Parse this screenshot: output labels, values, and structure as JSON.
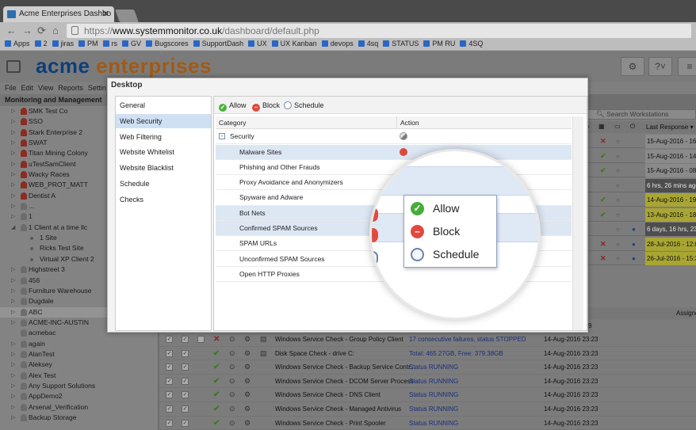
{
  "browser": {
    "tab_title": "Acme Enterprises Dashbo",
    "url_scheme": "https://",
    "url_host": "www.systemmonitor.co.uk",
    "url_path": "/dashboard/default.php",
    "bookmarks": [
      "Apps",
      "2",
      "jiras",
      "PM",
      "rs",
      "GV",
      "Bugscores",
      "SupportDash",
      "UX",
      "UX Kanban",
      "devops",
      "4sq",
      "STATUS",
      "PM RU",
      "4SQ"
    ]
  },
  "app": {
    "title_part1": "acme",
    "title_part2": "enterprises",
    "menu": [
      "File",
      "Edit",
      "View",
      "Reports",
      "Settin"
    ]
  },
  "left_panel": {
    "title": "Monitoring and Management",
    "items": [
      {
        "label": "SMK Test Co",
        "icon": "red-client-icon"
      },
      {
        "label": "SSO",
        "icon": "red-client-icon"
      },
      {
        "label": "Stark Enterprise 2",
        "icon": "red-client-icon"
      },
      {
        "label": "SWAT",
        "icon": "red-client-icon"
      },
      {
        "label": "Titan Mining Colony",
        "icon": "red-client-icon"
      },
      {
        "label": "uTestSamClient",
        "icon": "red-client-icon"
      },
      {
        "label": "Wacky Races",
        "icon": "red-client-icon"
      },
      {
        "label": "WEB_PROT_MATT",
        "icon": "red-client-icon"
      },
      {
        "label": "Dentist A",
        "icon": "red-client-icon"
      },
      {
        "label": "...",
        "icon": "grey-client-icon"
      },
      {
        "label": "1",
        "icon": "grey-client-icon"
      },
      {
        "label": "1 Client at a time llc",
        "icon": "grey-client-icon"
      },
      {
        "label": "1 Site",
        "icon": "site-dot-icon"
      },
      {
        "label": "Ricks Test Site",
        "icon": "site-dot-icon"
      },
      {
        "label": "Virtual XP Client 2",
        "icon": "site-dot-icon"
      },
      {
        "label": "Highstreet 3",
        "icon": "grey-client-icon"
      },
      {
        "label": "456",
        "icon": "grey-client-icon"
      },
      {
        "label": "Furniture Warehouse",
        "icon": "grey-client-icon"
      },
      {
        "label": "Dugdale",
        "icon": "grey-client-icon"
      },
      {
        "label": "ABC",
        "icon": "grey-client-icon"
      },
      {
        "label": "ACME-INC-AUSTIN",
        "icon": "grey-client-icon"
      },
      {
        "label": "acmebac",
        "icon": "grey-client-icon"
      },
      {
        "label": "again",
        "icon": "grey-client-icon"
      },
      {
        "label": "AlanTest",
        "icon": "grey-client-icon"
      },
      {
        "label": "Aleksey",
        "icon": "grey-client-icon"
      },
      {
        "label": "Alex Test",
        "icon": "grey-client-icon"
      },
      {
        "label": "Any Support Solutions",
        "icon": "grey-client-icon"
      },
      {
        "label": "AppDemo2",
        "icon": "grey-client-icon"
      },
      {
        "label": "Arsenal_Verification",
        "icon": "grey-client-icon"
      },
      {
        "label": "Backup Storage",
        "icon": "grey-client-icon"
      }
    ]
  },
  "workstations": {
    "search_placeholder": "Search Workstations",
    "col_last_response": "Last Response",
    "assignee_header": "Assigne",
    "rows": [
      {
        "status": "✕",
        "last_response": "15-Aug-2016 - 16:1"
      },
      {
        "status": "✔",
        "last_response": "15-Aug-2016 - 14:1"
      },
      {
        "status": "✔",
        "last_response": "15-Aug-2016 - 08:2"
      },
      {
        "status": "",
        "last_response": "6 hrs, 26 mins ago"
      },
      {
        "status": "✔",
        "last_response": "14-Aug-2016 - 19:0"
      },
      {
        "status": "✔",
        "last_response": "13-Aug-2016 - 18:1"
      },
      {
        "status": "",
        "last_response": "6 days, 16 hrs, 23 m"
      },
      {
        "status": "✕",
        "last_response": "28-Jul-2016 - 12:07"
      },
      {
        "status": "✕",
        "last_response": "26-Jul-2016 - 15:32"
      }
    ]
  },
  "checks": {
    "partial_top": "9",
    "rows": [
      {
        "status": "✕",
        "desc": "Windows Service Check - Group Policy Client",
        "result": "17 consecutive failures, status STOPPED",
        "date": "14-Aug-2016 23:23"
      },
      {
        "status": "✔",
        "desc": "Disk Space Check - drive C:",
        "result": "Total: 465.27GB, Free: 379.38GB",
        "date": "14-Aug-2016 23:23"
      },
      {
        "status": "✔",
        "desc": "Windows Service Check - Backup Service Contr...",
        "result": "Status RUNNING",
        "date": "14-Aug-2016 23:23"
      },
      {
        "status": "✔",
        "desc": "Windows Service Check - DCOM Server Process ...",
        "result": "Status RUNNING",
        "date": "14-Aug-2016 23:23"
      },
      {
        "status": "✔",
        "desc": "Windows Service Check - DNS Client",
        "result": "Status RUNNING",
        "date": "14-Aug-2016 23:23"
      },
      {
        "status": "✔",
        "desc": "Windows Service Check - Managed Antivirus",
        "result": "Status RUNNING",
        "date": "14-Aug-2016 23:23"
      },
      {
        "status": "✔",
        "desc": "Windows Service Check - Print Spooler",
        "result": "Status RUNNING",
        "date": "14-Aug-2016 23:23"
      }
    ]
  },
  "dialog": {
    "title": "Desktop",
    "nav": [
      "General",
      "Web Security",
      "Web Filtering",
      "Website Whitelist",
      "Website Blacklist",
      "Schedule",
      "Checks"
    ],
    "toolbar": {
      "allow": "Allow",
      "block": "Block",
      "schedule": "Schedule"
    },
    "table": {
      "col_category": "Category",
      "col_action": "Action",
      "group": "Security",
      "rows": [
        {
          "name": "Malware Sites",
          "action": "block"
        },
        {
          "name": "Phishing and Other Frauds",
          "action": "block"
        },
        {
          "name": "Proxy Avoidance and Anonymizers",
          "action": ""
        },
        {
          "name": "Spyware and Adware",
          "action": ""
        },
        {
          "name": "Bot Nets",
          "action": "block"
        },
        {
          "name": "Confirmed SPAM Sources",
          "action": "block"
        },
        {
          "name": "SPAM URLs",
          "action": "schedule"
        },
        {
          "name": "Unconfirmed SPAM Sources",
          "action": "schedule"
        },
        {
          "name": "Open HTTP Proxies",
          "action": ""
        }
      ]
    },
    "context_menu": {
      "allow": "Allow",
      "block": "Block",
      "schedule": "Schedule"
    }
  }
}
